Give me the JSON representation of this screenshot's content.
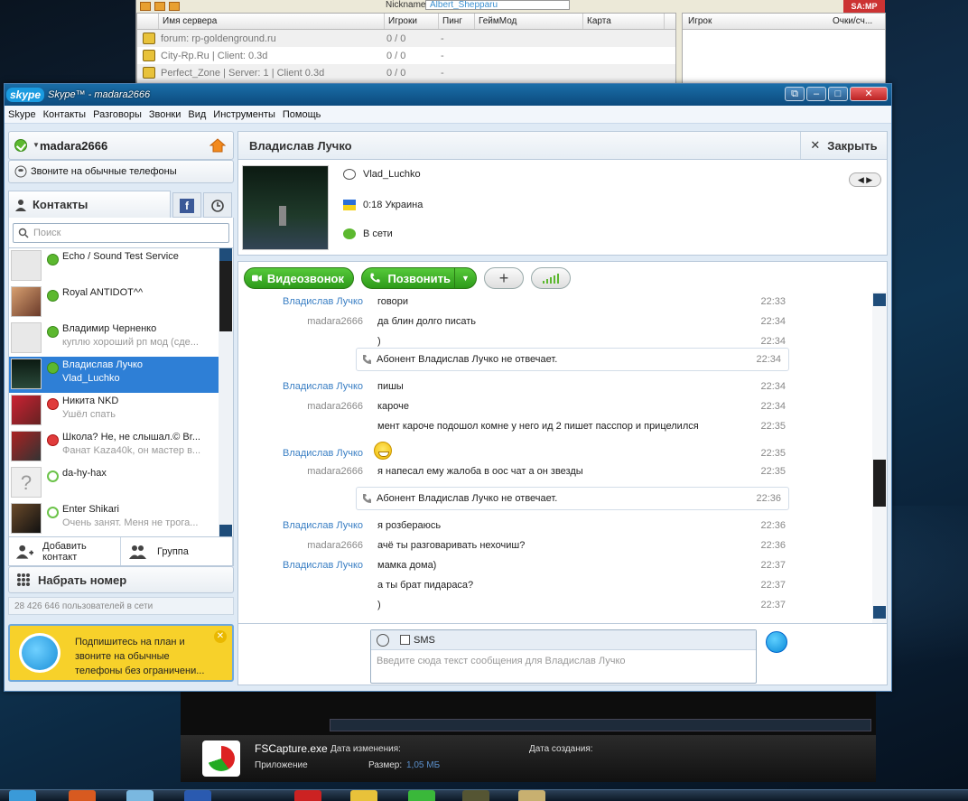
{
  "samp": {
    "nick_label": "Nickname:",
    "nick_value": "Albert_Shepparu",
    "badge": "SA:MP",
    "headers": [
      "Имя сервера",
      "Игроки",
      "Пинг",
      "ГеймМод",
      "Карта"
    ],
    "rows": [
      {
        "name": "forum: rp-goldenground.ru",
        "players": "0 / 0",
        "ping": "-"
      },
      {
        "name": "City-Rp.Ru | Client: 0.3d",
        "players": "0 / 0",
        "ping": "-"
      },
      {
        "name": "Perfect_Zone | Server: 1 | Client 0.3d",
        "players": "0 / 0",
        "ping": "-"
      }
    ],
    "player_headers": [
      "Игрок",
      "Очки/сч..."
    ]
  },
  "fscapture": {
    "file": "FSCapture.exe",
    "type": "Приложение",
    "modified_label": "Дата изменения:",
    "created_label": "Дата создания:",
    "size_label": "Размер:",
    "size": "1,05 МБ"
  },
  "skype": {
    "logo": "skype",
    "title": "Skype™ - madara2666",
    "menu": [
      "Skype",
      "Контакты",
      "Разговоры",
      "Звонки",
      "Вид",
      "Инструменты",
      "Помощь"
    ],
    "username": "madara2666",
    "call_phones": "Звоните на обычные телефоны",
    "contacts_tab": "Контакты",
    "search_placeholder": "Поиск",
    "contacts": [
      {
        "name": "Echo / Sound Test Service",
        "sub": "",
        "status": "on"
      },
      {
        "name": "Royal ANTIDOT^^",
        "sub": "",
        "status": "on"
      },
      {
        "name": "Владимир Черненко",
        "sub": "куплю хороший рп мод (сде...",
        "status": "on"
      },
      {
        "name": "Владислав Лучко",
        "sub": "Vlad_Luchko",
        "status": "on",
        "selected": true
      },
      {
        "name": "Никита NKD",
        "sub": "Ушёл спать",
        "status": "away"
      },
      {
        "name": "Школа? Не, не слышал.© Br...",
        "sub": "Фанат Kaza40k, он мастер в...",
        "status": "away"
      },
      {
        "name": "da-hy-hax",
        "sub": "",
        "status": "off"
      },
      {
        "name": "Enter Shikari",
        "sub": "Очень занят. Меня не трога...",
        "status": "off"
      }
    ],
    "add_contact": "Добавить контакт",
    "group": "Группа",
    "dial": "Набрать номер",
    "online_count": "28 426 646 пользователей в сети",
    "promo": "Подпишитесь на план и звоните на обычные телефоны без ограничени...",
    "chat": {
      "name": "Владислав Лучко",
      "close": "Закрыть",
      "skype_name": "Vlad_Luchko",
      "local_time": "0:18 Украина",
      "status": "В сети",
      "video_btn": "Видеозвонок",
      "call_btn": "Позвонить",
      "messages": [
        {
          "who": "Владислав Лучко",
          "side": "them",
          "text": "говори",
          "time": "22:33"
        },
        {
          "who": "madara2666",
          "side": "me",
          "text": "да блин долго писать",
          "time": "22:34"
        },
        {
          "who": "",
          "side": "me",
          "text": ")",
          "time": "22:34"
        },
        {
          "who": "",
          "side": "sys",
          "text": "Абонент Владислав Лучко не отвечает.",
          "time": "22:34"
        },
        {
          "who": "Владислав Лучко",
          "side": "them",
          "text": "пишы",
          "time": "22:34"
        },
        {
          "who": "madara2666",
          "side": "me",
          "text": "кароче",
          "time": "22:34"
        },
        {
          "who": "",
          "side": "me",
          "text": "мент кароче подошол комне у него ид 2 пишет пасспор и прицелился",
          "time": "22:35"
        },
        {
          "who": "Владислав Лучко",
          "side": "them",
          "text": "",
          "time": "22:35"
        },
        {
          "who": "madara2666",
          "side": "me",
          "text": "я напесал ему жалоба в оос чат а он звезды",
          "time": "22:35"
        },
        {
          "who": "",
          "side": "sys",
          "text": "Абонент Владислав Лучко не отвечает.",
          "time": "22:36"
        },
        {
          "who": "Владислав Лучко",
          "side": "them",
          "text": "я розбераюсь",
          "time": "22:36"
        },
        {
          "who": "madara2666",
          "side": "me",
          "text": "ачё ты разговаривать нехочиш?",
          "time": "22:36"
        },
        {
          "who": "Владислав Лучко",
          "side": "them",
          "text": "мамка дома)",
          "time": "22:37"
        },
        {
          "who": "",
          "side": "them",
          "text": "а ты брат пидараса?",
          "time": "22:37"
        },
        {
          "who": "",
          "side": "them",
          "text": ")",
          "time": "22:37"
        }
      ],
      "sms_label": "SMS",
      "input_placeholder": "Введите сюда текст сообщения для Владислав Лучко"
    }
  },
  "colors": {
    "skype_blue": "#0c4a7d",
    "call_green": "#3aaa22",
    "selection": "#2e7fd6",
    "promo_yellow": "#f7d12a"
  }
}
